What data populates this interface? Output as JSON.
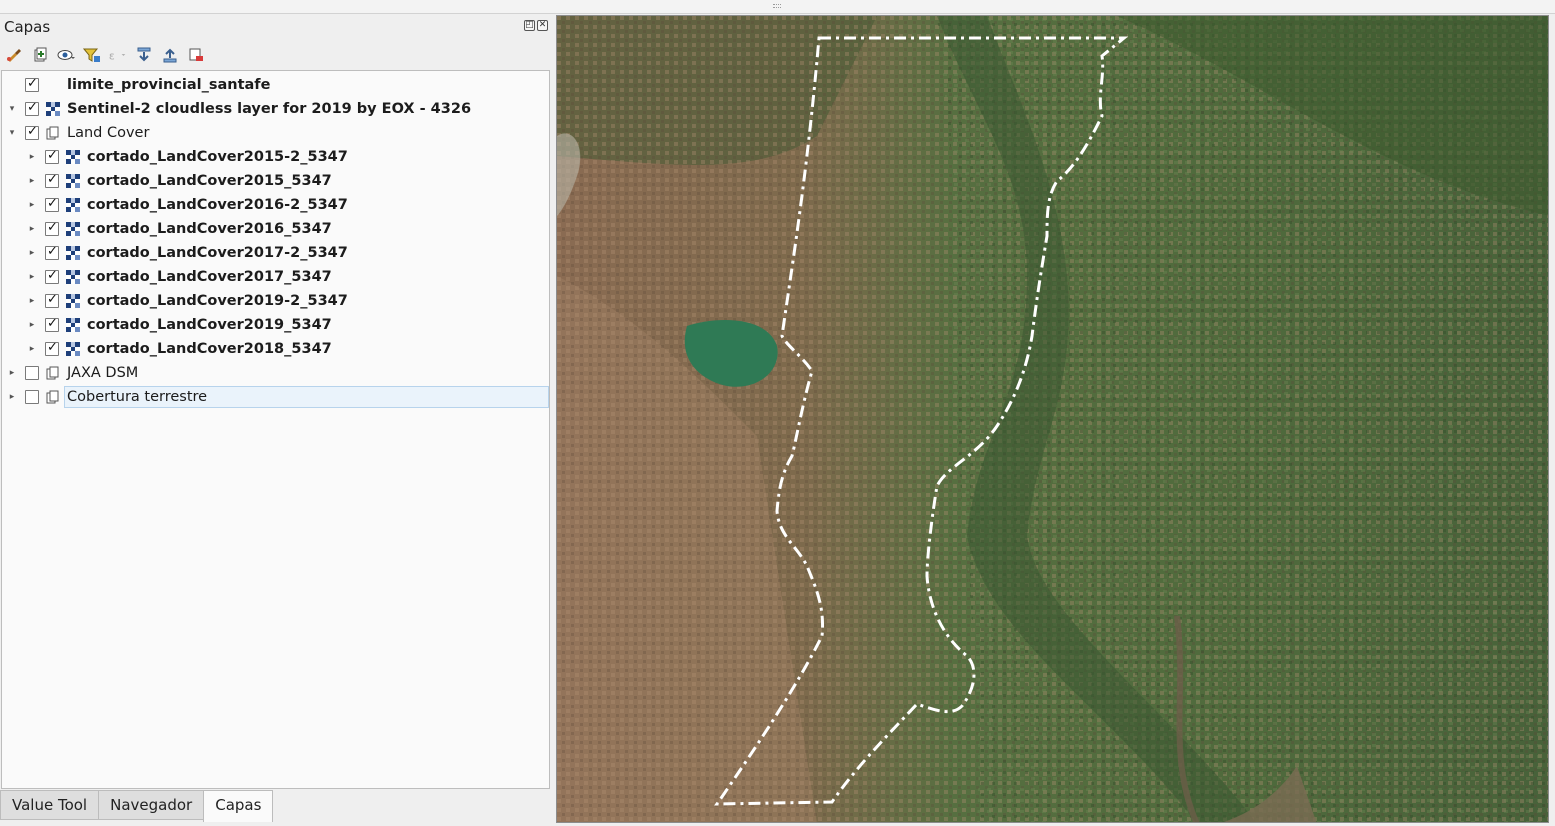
{
  "dock": {
    "title": "Capas",
    "float_icon": "float-icon",
    "close_icon": "close-icon"
  },
  "toolbar": [
    {
      "name": "style-manager-icon"
    },
    {
      "name": "add-group-icon"
    },
    {
      "name": "map-themes-icon"
    },
    {
      "name": "filter-legend-icon"
    },
    {
      "name": "filter-expression-icon"
    },
    {
      "name": "expand-all-icon"
    },
    {
      "name": "collapse-all-icon"
    },
    {
      "name": "remove-layer-icon"
    }
  ],
  "layers": [
    {
      "label": "limite_provincial_santafe",
      "checked": true,
      "bold": true,
      "arrow": "",
      "icon": "none",
      "indent": 0
    },
    {
      "label": "Sentinel-2 cloudless layer for 2019 by EOX - 4326",
      "checked": true,
      "bold": true,
      "arrow": "down",
      "icon": "raster",
      "indent": 0
    },
    {
      "label": "Land Cover",
      "checked": true,
      "bold": false,
      "arrow": "down",
      "icon": "group",
      "indent": 0
    },
    {
      "label": "cortado_LandCover2015-2_5347",
      "checked": true,
      "bold": true,
      "arrow": "right",
      "icon": "raster",
      "indent": 1
    },
    {
      "label": "cortado_LandCover2015_5347",
      "checked": true,
      "bold": true,
      "arrow": "right",
      "icon": "raster",
      "indent": 1
    },
    {
      "label": "cortado_LandCover2016-2_5347",
      "checked": true,
      "bold": true,
      "arrow": "right",
      "icon": "raster",
      "indent": 1
    },
    {
      "label": "cortado_LandCover2016_5347",
      "checked": true,
      "bold": true,
      "arrow": "right",
      "icon": "raster",
      "indent": 1
    },
    {
      "label": "cortado_LandCover2017-2_5347",
      "checked": true,
      "bold": true,
      "arrow": "right",
      "icon": "raster",
      "indent": 1
    },
    {
      "label": "cortado_LandCover2017_5347",
      "checked": true,
      "bold": true,
      "arrow": "right",
      "icon": "raster",
      "indent": 1
    },
    {
      "label": "cortado_LandCover2019-2_5347",
      "checked": true,
      "bold": true,
      "arrow": "right",
      "icon": "raster",
      "indent": 1
    },
    {
      "label": "cortado_LandCover2019_5347",
      "checked": true,
      "bold": true,
      "arrow": "right",
      "icon": "raster",
      "indent": 1
    },
    {
      "label": "cortado_LandCover2018_5347",
      "checked": true,
      "bold": true,
      "arrow": "right",
      "icon": "raster",
      "indent": 1
    },
    {
      "label": "JAXA DSM",
      "checked": false,
      "bold": false,
      "arrow": "right",
      "icon": "group",
      "indent": 0
    },
    {
      "label": "Cobertura terrestre",
      "checked": false,
      "bold": false,
      "arrow": "right",
      "icon": "group",
      "indent": 0,
      "selected": true
    }
  ],
  "tabs": [
    {
      "label": "Value Tool",
      "active": false
    },
    {
      "label": "Navegador",
      "active": false
    },
    {
      "label": "Capas",
      "active": true
    }
  ],
  "map": {
    "name": "map-canvas",
    "boundary_color": "#ffffff",
    "colors": {
      "dark_green": "#3f5b33",
      "green": "#5a7444",
      "brown": "#8c6d52",
      "tan": "#a5856a",
      "lagoon": "#2f7a55",
      "river": "#6b5e49"
    }
  }
}
